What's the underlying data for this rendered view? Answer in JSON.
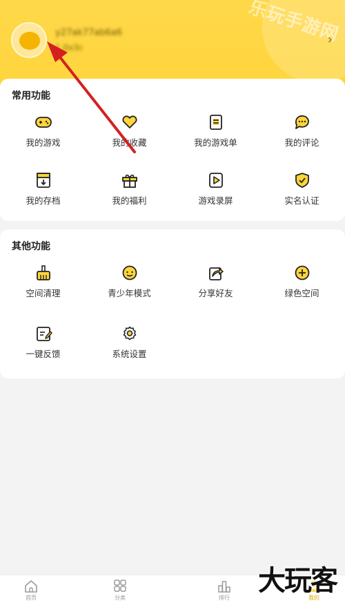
{
  "header": {
    "user_name": "y27ak77ab6a6",
    "user_id": "1,0x3c",
    "watermark": "乐玩手游网"
  },
  "common": {
    "title": "常用功能",
    "items": [
      {
        "label": "我的游戏",
        "icon": "gamepad-icon"
      },
      {
        "label": "我的收藏",
        "icon": "heart-icon"
      },
      {
        "label": "我的游戏单",
        "icon": "list-doc-icon"
      },
      {
        "label": "我的评论",
        "icon": "comment-icon"
      },
      {
        "label": "我的存档",
        "icon": "save-archive-icon"
      },
      {
        "label": "我的福利",
        "icon": "gift-icon"
      },
      {
        "label": "游戏录屏",
        "icon": "record-play-icon"
      },
      {
        "label": "实名认证",
        "icon": "shield-check-icon"
      }
    ]
  },
  "other": {
    "title": "其他功能",
    "items": [
      {
        "label": "空间清理",
        "icon": "broom-icon"
      },
      {
        "label": "青少年模式",
        "icon": "child-face-icon"
      },
      {
        "label": "分享好友",
        "icon": "share-icon"
      },
      {
        "label": "绿色空间",
        "icon": "plus-circle-icon"
      },
      {
        "label": "一键反馈",
        "icon": "feedback-edit-icon"
      },
      {
        "label": "系统设置",
        "icon": "gear-icon"
      }
    ]
  },
  "tabbar": [
    {
      "label": "首页",
      "icon": "home-icon",
      "active": false
    },
    {
      "label": "分类",
      "icon": "grid-icon",
      "active": false
    },
    {
      "label": "排行",
      "icon": "ranking-icon",
      "active": false
    },
    {
      "label": "我的",
      "icon": "profile-icon",
      "active": true
    }
  ],
  "colors": {
    "accent": "#ffd53a",
    "icon_fill": "#ffd53a",
    "icon_stroke": "#222222"
  },
  "bottom_watermark": "大玩客"
}
